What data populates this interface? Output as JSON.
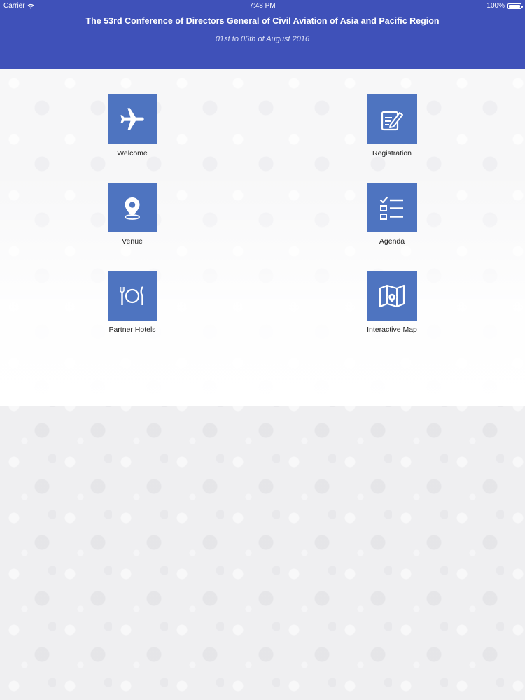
{
  "status_bar": {
    "carrier": "Carrier",
    "time": "7:48 PM",
    "battery": "100%"
  },
  "header": {
    "title": "The 53rd Conference of Directors General of Civil Aviation of Asia and Pacific Region",
    "subtitle": "01st to 05th of August 2016",
    "background_color": "#3f51b9"
  },
  "menu": {
    "tile_color": "#4e74c0",
    "items": [
      {
        "label": "Welcome",
        "icon": "airplane-icon"
      },
      {
        "label": "Registration",
        "icon": "edit-form-icon"
      },
      {
        "label": "Venue",
        "icon": "location-pin-icon"
      },
      {
        "label": "Agenda",
        "icon": "checklist-icon"
      },
      {
        "label": "Partner Hotels",
        "icon": "dining-icon"
      },
      {
        "label": "Interactive Map",
        "icon": "map-icon"
      }
    ]
  }
}
